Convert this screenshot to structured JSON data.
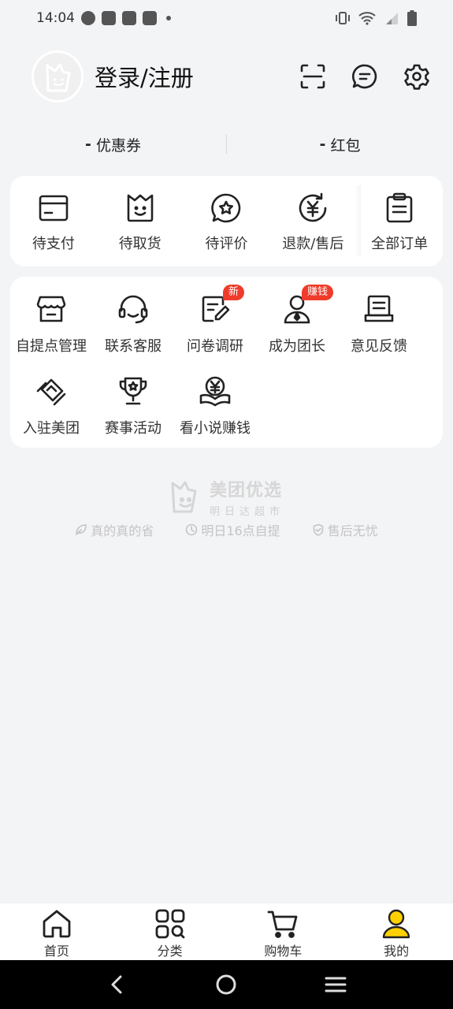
{
  "status_bar": {
    "time": "14:04"
  },
  "header": {
    "login_label": "登录/注册"
  },
  "assets": [
    {
      "value": "-",
      "label": "优惠券"
    },
    {
      "value": "-",
      "label": "红包"
    }
  ],
  "orders": [
    {
      "label": "待支付",
      "icon": "wallet-icon"
    },
    {
      "label": "待取货",
      "icon": "bag-icon"
    },
    {
      "label": "待评价",
      "icon": "star-bubble-icon"
    },
    {
      "label": "退款/售后",
      "icon": "refund-icon"
    },
    {
      "label": "全部订单",
      "icon": "clipboard-icon"
    }
  ],
  "services": {
    "row1": [
      {
        "label": "自提点管理",
        "icon": "store-icon"
      },
      {
        "label": "联系客服",
        "icon": "headset-icon"
      },
      {
        "label": "问卷调研",
        "icon": "survey-icon",
        "badge": "新"
      },
      {
        "label": "成为团长",
        "icon": "leader-icon",
        "badge": "赚钱"
      },
      {
        "label": "意见反馈",
        "icon": "feedback-icon"
      }
    ],
    "row2": [
      {
        "label": "入驻美团",
        "icon": "handshake-icon"
      },
      {
        "label": "赛事活动",
        "icon": "trophy-icon"
      },
      {
        "label": "看小说赚钱",
        "icon": "book-coin-icon"
      }
    ]
  },
  "brand": {
    "name": "美团优选",
    "sub": "明日达超市"
  },
  "promises": [
    "真的真的省",
    "明日16点自提",
    "售后无忧"
  ],
  "tabs": [
    {
      "label": "首页",
      "icon": "home-icon",
      "active": false
    },
    {
      "label": "分类",
      "icon": "category-icon",
      "active": false
    },
    {
      "label": "购物车",
      "icon": "cart-icon",
      "active": false
    },
    {
      "label": "我的",
      "icon": "profile-icon",
      "active": true
    }
  ],
  "colors": {
    "accent_yellow": "#ffd100",
    "badge_red": "#f03b2a",
    "icon_stroke": "#222222"
  }
}
